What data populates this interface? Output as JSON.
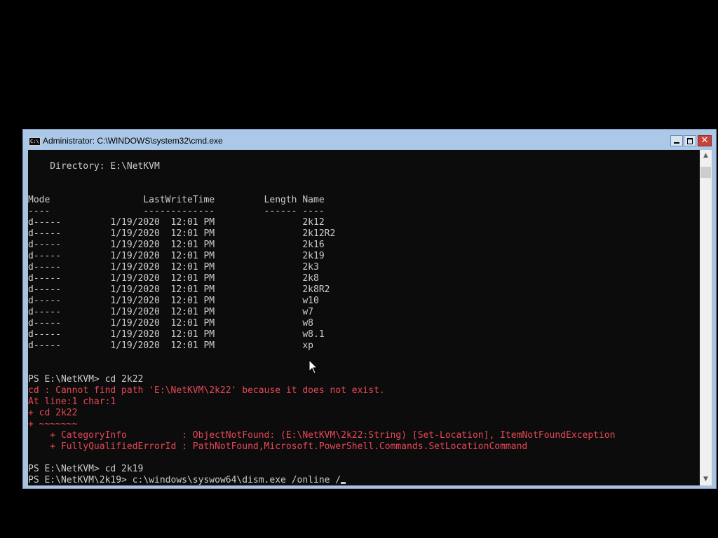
{
  "window": {
    "title": "Administrator: C:\\WINDOWS\\system32\\cmd.exe",
    "icon": "cmd-icon",
    "icon_text": "C:\\",
    "buttons": {
      "minimize": "minimize-icon",
      "maximize": "maximize-icon",
      "close": "close-icon",
      "close_glyph": "✕"
    }
  },
  "console": {
    "colors": {
      "background": "#0c0c0c",
      "text": "#cccccc",
      "error": "#e74856"
    },
    "lines": [
      {
        "text": "    Directory: E:\\NetKVM",
        "style": "normal"
      },
      {
        "text": "",
        "style": "normal"
      },
      {
        "text": "",
        "style": "normal"
      },
      {
        "text": "Mode                 LastWriteTime         Length Name",
        "style": "normal"
      },
      {
        "text": "----                 -------------         ------ ----",
        "style": "normal"
      },
      {
        "text": "d-----         1/19/2020  12:01 PM                2k12",
        "style": "normal"
      },
      {
        "text": "d-----         1/19/2020  12:01 PM                2k12R2",
        "style": "normal"
      },
      {
        "text": "d-----         1/19/2020  12:01 PM                2k16",
        "style": "normal"
      },
      {
        "text": "d-----         1/19/2020  12:01 PM                2k19",
        "style": "normal"
      },
      {
        "text": "d-----         1/19/2020  12:01 PM                2k3",
        "style": "normal"
      },
      {
        "text": "d-----         1/19/2020  12:01 PM                2k8",
        "style": "normal"
      },
      {
        "text": "d-----         1/19/2020  12:01 PM                2k8R2",
        "style": "normal"
      },
      {
        "text": "d-----         1/19/2020  12:01 PM                w10",
        "style": "normal"
      },
      {
        "text": "d-----         1/19/2020  12:01 PM                w7",
        "style": "normal"
      },
      {
        "text": "d-----         1/19/2020  12:01 PM                w8",
        "style": "normal"
      },
      {
        "text": "d-----         1/19/2020  12:01 PM                w8.1",
        "style": "normal"
      },
      {
        "text": "d-----         1/19/2020  12:01 PM                xp",
        "style": "normal"
      },
      {
        "text": "",
        "style": "normal"
      },
      {
        "text": "",
        "style": "normal"
      },
      {
        "text": "PS E:\\NetKVM> cd 2k22",
        "style": "normal"
      },
      {
        "text": "cd : Cannot find path 'E:\\NetKVM\\2k22' because it does not exist.",
        "style": "error"
      },
      {
        "text": "At line:1 char:1",
        "style": "error"
      },
      {
        "text": "+ cd 2k22",
        "style": "error"
      },
      {
        "text": "+ ~~~~~~~",
        "style": "error"
      },
      {
        "text": "    + CategoryInfo          : ObjectNotFound: (E:\\NetKVM\\2k22:String) [Set-Location], ItemNotFoundException",
        "style": "error"
      },
      {
        "text": "    + FullyQualifiedErrorId : PathNotFound,Microsoft.PowerShell.Commands.SetLocationCommand",
        "style": "error"
      },
      {
        "text": "",
        "style": "normal"
      },
      {
        "text": "PS E:\\NetKVM> cd 2k19",
        "style": "normal"
      }
    ],
    "current_prompt": "PS E:\\NetKVM\\2k19> ",
    "current_input": "c:\\windows\\syswow64\\dism.exe /online /"
  },
  "scrollbar": {
    "up_icon": "scroll-up-arrow-icon",
    "down_icon": "scroll-down-arrow-icon",
    "up_glyph": "▲",
    "down_glyph": "▼"
  }
}
